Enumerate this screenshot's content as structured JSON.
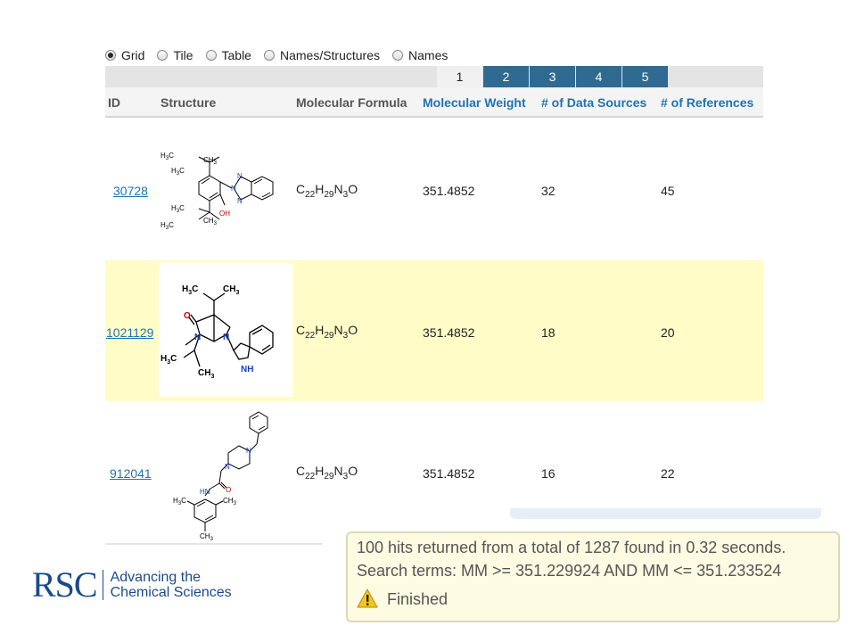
{
  "view_options": [
    {
      "label": "Grid",
      "selected": true
    },
    {
      "label": "Tile",
      "selected": false
    },
    {
      "label": "Table",
      "selected": false
    },
    {
      "label": "Names/Structures",
      "selected": false
    },
    {
      "label": "Names",
      "selected": false
    }
  ],
  "pager": {
    "pages": [
      "1",
      "2",
      "3",
      "4",
      "5"
    ],
    "current": "1"
  },
  "columns": {
    "id": "ID",
    "structure": "Structure",
    "formula": "Molecular Formula",
    "weight": "Molecular Weight",
    "sources": "# of Data Sources",
    "references": "# of References"
  },
  "rows": [
    {
      "id": "30728",
      "formula": {
        "c": "C",
        "c_n": "22",
        "h": "H",
        "h_n": "29",
        "n": "N",
        "n_n": "3",
        "o": "O"
      },
      "weight": "351.4852",
      "sources": "32",
      "references": "45",
      "structure_labels": {
        "a": "H",
        "a_sub": "3",
        "a2": "C",
        "b": "CH",
        "b_sub": "3",
        "c": "H",
        "c_sub": "3",
        "c2": "C",
        "d": "H",
        "d_sub": "3",
        "d2": "C",
        "e": "CH",
        "e_sub": "3",
        "f": "H",
        "f_sub": "3",
        "f2": "C",
        "oh": "OH",
        "n": "N"
      }
    },
    {
      "id": "1021129",
      "formula": {
        "c": "C",
        "c_n": "22",
        "h": "H",
        "h_n": "29",
        "n": "N",
        "n_n": "3",
        "o": "O"
      },
      "weight": "351.4852",
      "sources": "18",
      "references": "20",
      "structure_labels": {
        "h3c": "H",
        "h3c_sub": "3",
        "h3c2": "C",
        "ch3": "CH",
        "ch3_sub": "3",
        "o": "O",
        "n": "N",
        "nh": "NH"
      }
    },
    {
      "id": "912041",
      "formula": {
        "c": "C",
        "c_n": "22",
        "h": "H",
        "h_n": "29",
        "n": "N",
        "n_n": "3",
        "o": "O"
      },
      "weight": "351.4852",
      "sources": "16",
      "references": "22",
      "structure_labels": {
        "n": "N",
        "hn": "HN",
        "o": "O",
        "h3c": "H",
        "h3c_sub": "3",
        "h3c2": "C",
        "ch3": "CH",
        "ch3_sub": "3"
      }
    }
  ],
  "status": {
    "line1": "100 hits returned from a total of 1287 found in 0.32 seconds.",
    "line2": "Search terms: MM >= 351.229924 AND MM <= 351.233524",
    "line3": "Finished"
  },
  "logo": {
    "mark": "RSC",
    "tag1": "Advancing the",
    "tag2": "Chemical Sciences"
  },
  "colors": {
    "accent": "#1f73b0",
    "pager_active": "#2f6a93",
    "row_highlight": "#fffcc8",
    "status_bg": "#fdfbe2",
    "brand": "#1a4a8c"
  },
  "icons": {
    "status": "warning-icon"
  }
}
